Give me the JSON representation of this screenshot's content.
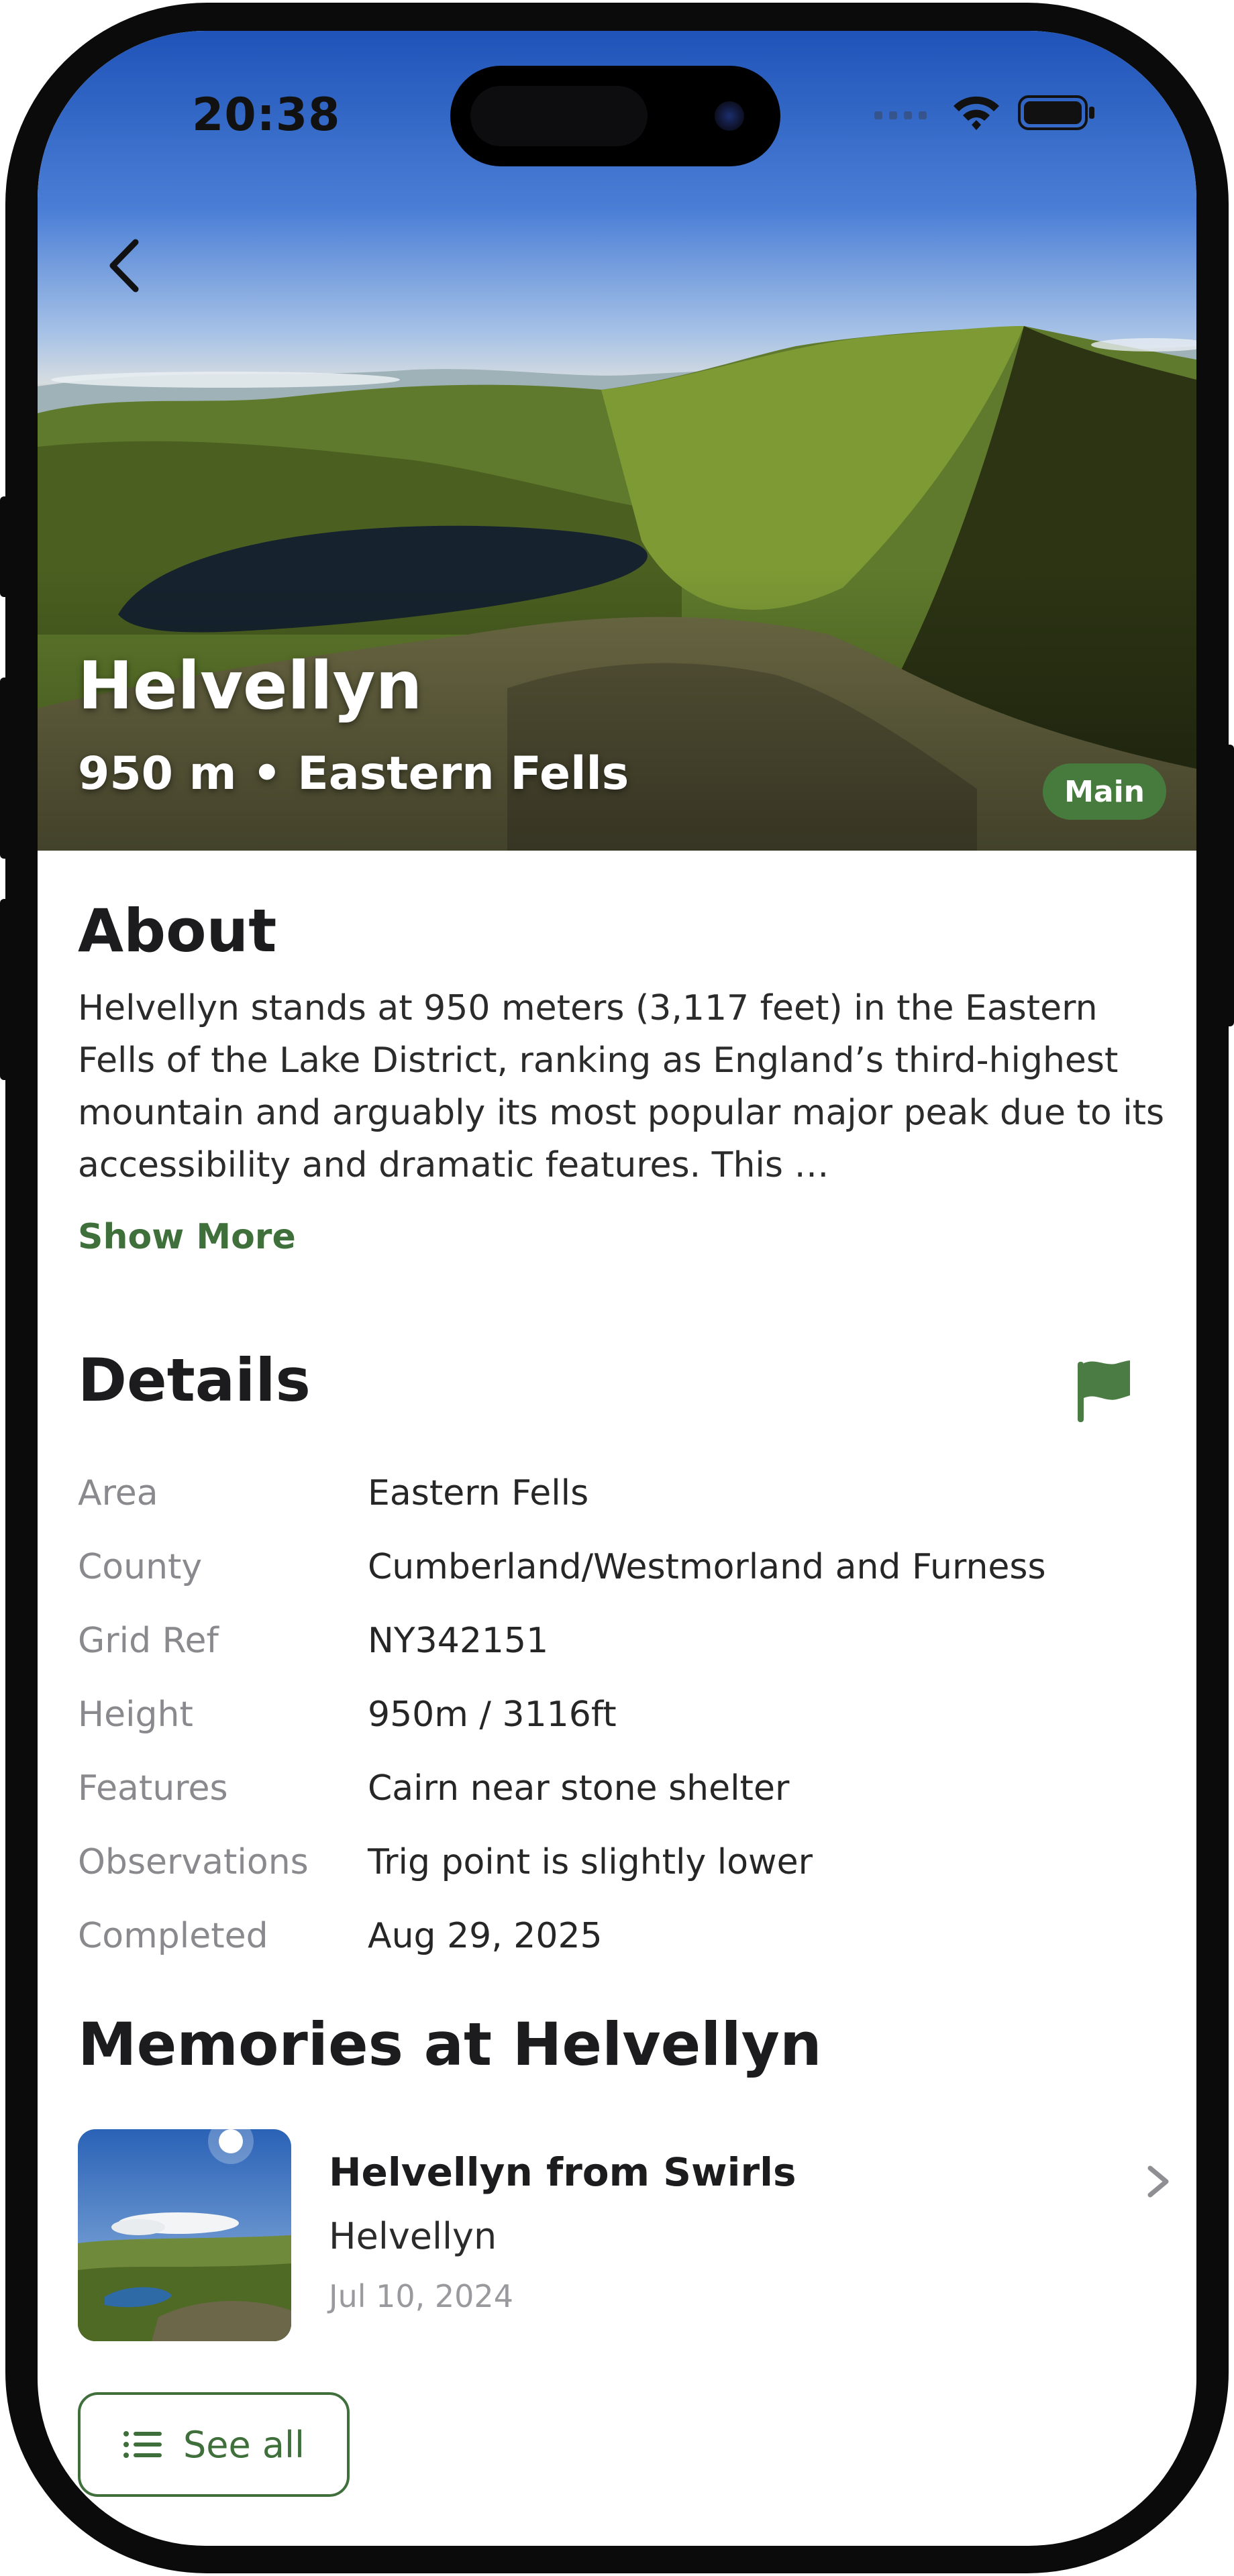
{
  "status_bar": {
    "time": "20:38"
  },
  "hero": {
    "title": "Helvellyn",
    "subtitle": "950 m • Eastern Fells",
    "badge": "Main"
  },
  "about": {
    "heading": "About",
    "text": "Helvellyn stands at 950 meters (3,117 feet) in the Eastern Fells of the Lake District, ranking as England’s third-highest mountain and arguably its most popular major peak due to its accessibility and dramatic features. This …",
    "show_more": "Show More"
  },
  "details": {
    "heading": "Details",
    "rows": [
      {
        "label": "Area",
        "value": "Eastern Fells"
      },
      {
        "label": "County",
        "value": "Cumberland/Westmorland and Furness"
      },
      {
        "label": "Grid Ref",
        "value": "NY342151"
      },
      {
        "label": "Height",
        "value": "950m / 3116ft"
      },
      {
        "label": "Features",
        "value": "Cairn near stone shelter"
      },
      {
        "label": "Observations",
        "value": "Trig point is slightly lower"
      },
      {
        "label": "Completed",
        "value": "Aug 29, 2025"
      }
    ]
  },
  "memories": {
    "heading": "Memories at Helvellyn",
    "items": [
      {
        "title": "Helvellyn from Swirls",
        "place": "Helvellyn",
        "date": "Jul 10, 2024"
      }
    ],
    "see_all": "See all"
  },
  "colors": {
    "accent": "#3f6f3a",
    "badge": "#477b3e"
  }
}
